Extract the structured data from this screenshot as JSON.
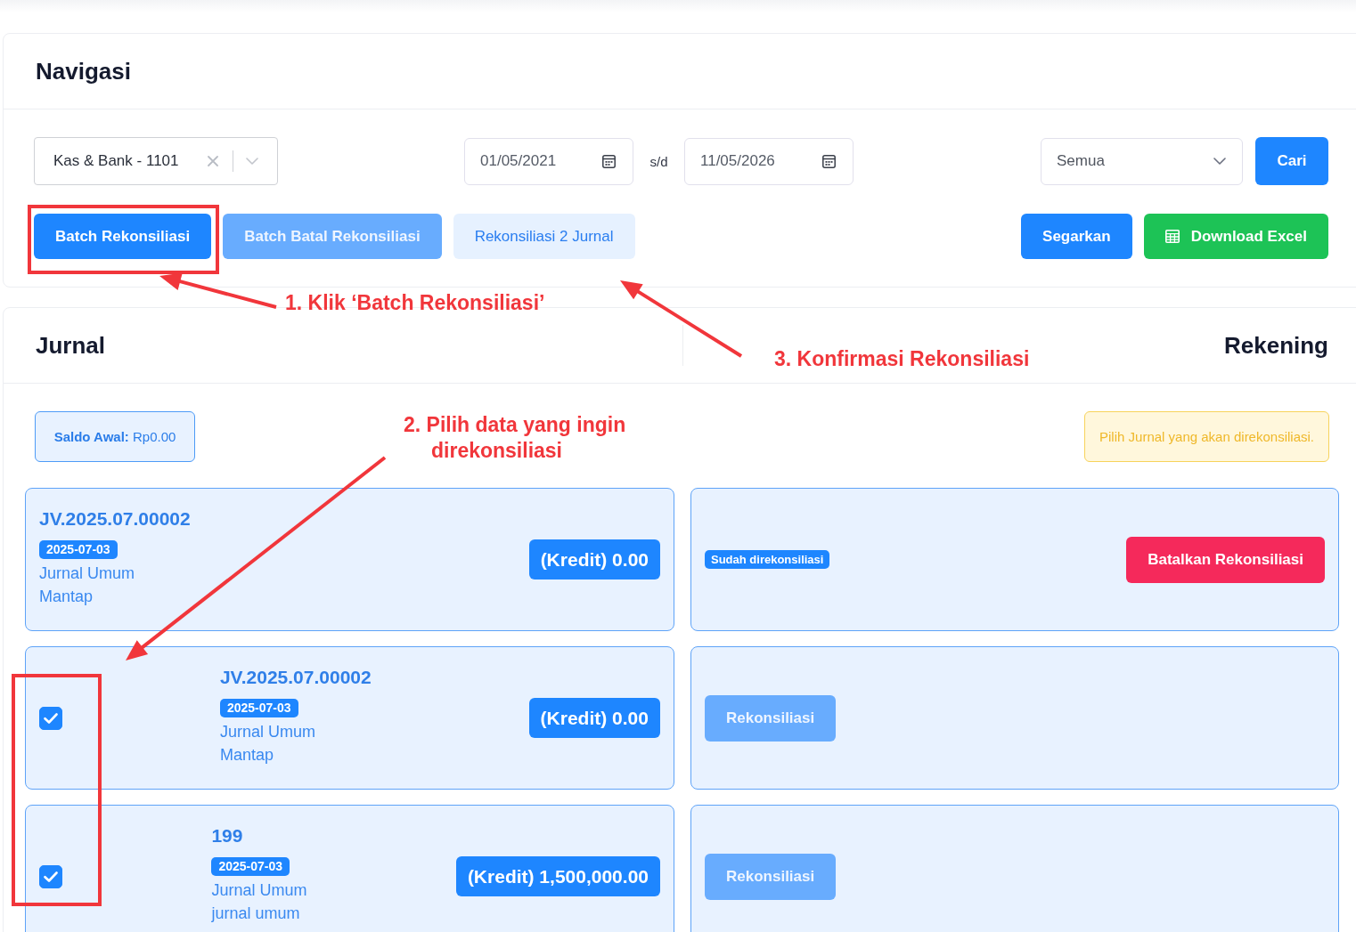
{
  "navigation": {
    "title": "Navigasi",
    "account_select": {
      "value": "Kas & Bank - 1101",
      "clearable": true
    },
    "date_from": "01/05/2021",
    "range_separator": "s/d",
    "date_to": "11/05/2026",
    "status_filter": {
      "value": "Semua"
    },
    "search_button": "Cari",
    "actions_left": [
      {
        "label": "Batch Rekonsiliasi",
        "kind": "primary",
        "disabled": false,
        "icon": false
      },
      {
        "label": "Batch Batal Rekonsiliasi",
        "kind": "primary",
        "disabled": true,
        "icon": false
      },
      {
        "label": "Rekonsiliasi 2 Jurnal",
        "kind": "light",
        "disabled": false,
        "icon": false
      }
    ],
    "actions_right": [
      {
        "label": "Segarkan",
        "kind": "primary",
        "disabled": false,
        "icon": false
      },
      {
        "label": "Download Excel",
        "kind": "success",
        "disabled": false,
        "icon": true
      }
    ]
  },
  "reconciliation": {
    "journal_title": "Jurnal",
    "account_title": "Rekening",
    "opening_balance": "**Saldo Awal:** Rp0.00",
    "notice": "Pilih Jurnal yang akan direkonsiliasi.",
    "rows": [
      {
        "journal": {
          "kind": "plain",
          "ref": "JV.2025.07.00002",
          "date": "2025-07-03",
          "type": "Jurnal Umum",
          "memo": "Mantap",
          "amount": "(Kredit) 0.00"
        },
        "account": {
          "status": "Sudah direkonsiliasi",
          "button": {
            "label": "Batalkan Rekonsiliasi",
            "kind": "danger",
            "disabled": false
          }
        }
      },
      {
        "journal": {
          "kind": "checkbox",
          "checked": true,
          "ref": "JV.2025.07.00002",
          "date": "2025-07-03",
          "type": "Jurnal Umum",
          "memo": "Mantap",
          "amount": "(Kredit) 0.00"
        },
        "account": {
          "button": {
            "label": "Rekonsiliasi",
            "kind": "primary",
            "disabled": true
          }
        }
      },
      {
        "journal": {
          "kind": "checkbox",
          "checked": true,
          "ref": "199",
          "date": "2025-07-03",
          "type": "Jurnal Umum",
          "memo": "jurnal umum",
          "amount": "(Kredit) 1,500,000.00"
        },
        "account": {
          "button": {
            "label": "Rekonsiliasi",
            "kind": "primary",
            "disabled": true
          }
        }
      }
    ]
  },
  "annotations": [
    {
      "text": "1. Klik ‘Batch Rekonsiliasi’",
      "arrow": true,
      "frame": true
    },
    {
      "text": "2. Pilih data yang ingin direkonsiliasi",
      "arrow": true,
      "frame": true
    },
    {
      "text": "3. Konfirmasi Rekonsiliasi",
      "arrow": true,
      "frame": false
    }
  ]
}
